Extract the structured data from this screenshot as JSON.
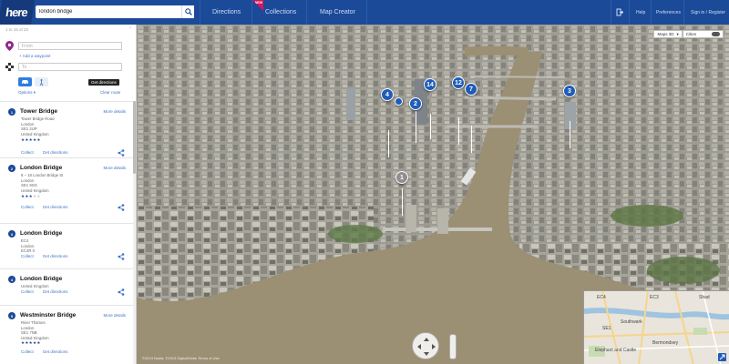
{
  "header": {
    "logo_text": "here",
    "search_value": "london bridge",
    "nav": [
      "Directions",
      "Collections",
      "Map Creator"
    ],
    "new_badge": "NEW",
    "help": "Help",
    "preferences": "Preferences",
    "signin": "Sign in / Register"
  },
  "panel": {
    "count_text": "1 to 15 of 23",
    "from_placeholder": "From",
    "to_placeholder": "To",
    "add_waypoint": "+ Add a waypoint",
    "tooltip": "Get directions",
    "options": "Options",
    "clear_route": "Clear route"
  },
  "results": [
    {
      "num": "1",
      "title": "Tower Bridge",
      "more": "More details",
      "address": [
        "Tower Bridge Road",
        "London",
        "SE1 2UP",
        "United Kingdom"
      ],
      "stars": 5,
      "collect": "Collect",
      "directions": "Get directions"
    },
    {
      "num": "2",
      "title": "London Bridge",
      "more": "More details",
      "address": [
        "8 – 18 London Bridge St",
        "London",
        "SE1 9SG",
        "United Kingdom"
      ],
      "stars": 3,
      "collect": "Collect",
      "directions": "Get directions"
    },
    {
      "num": "3",
      "title": "London Bridge",
      "more": "",
      "address": [
        "EC4",
        "London",
        "EC4R 0"
      ],
      "stars": 0,
      "collect": "Collect",
      "directions": "Get directions"
    },
    {
      "num": "4",
      "title": "London Bridge",
      "more": "",
      "address": [
        "United Kingdom"
      ],
      "stars": 0,
      "collect": "Collect",
      "directions": "Get directions"
    },
    {
      "num": "5",
      "title": "Westminster Bridge",
      "more": "More details",
      "address": [
        "River Thames",
        "London",
        "SE1 7NB",
        "United Kingdom"
      ],
      "stars": 5,
      "collect": "Collect",
      "directions": "Get directions"
    }
  ],
  "map": {
    "style": "Maps 3D",
    "layer": "Cities",
    "pins": [
      "1",
      "2",
      "3",
      "4",
      "7",
      "12",
      "14"
    ],
    "copyright": "©2013 Nokia, ©2013 DigitalGlobe Terms of Use",
    "minimap_labels": [
      "EC4",
      "EC3",
      "SE1",
      "Southwark",
      "Bermondsey",
      "Elephant and Castle",
      "Shad"
    ]
  },
  "colors": {
    "header": "#1b4a99",
    "accent": "#3b73c5",
    "pin": "#1f5cb8",
    "badge": "#d9145a"
  }
}
